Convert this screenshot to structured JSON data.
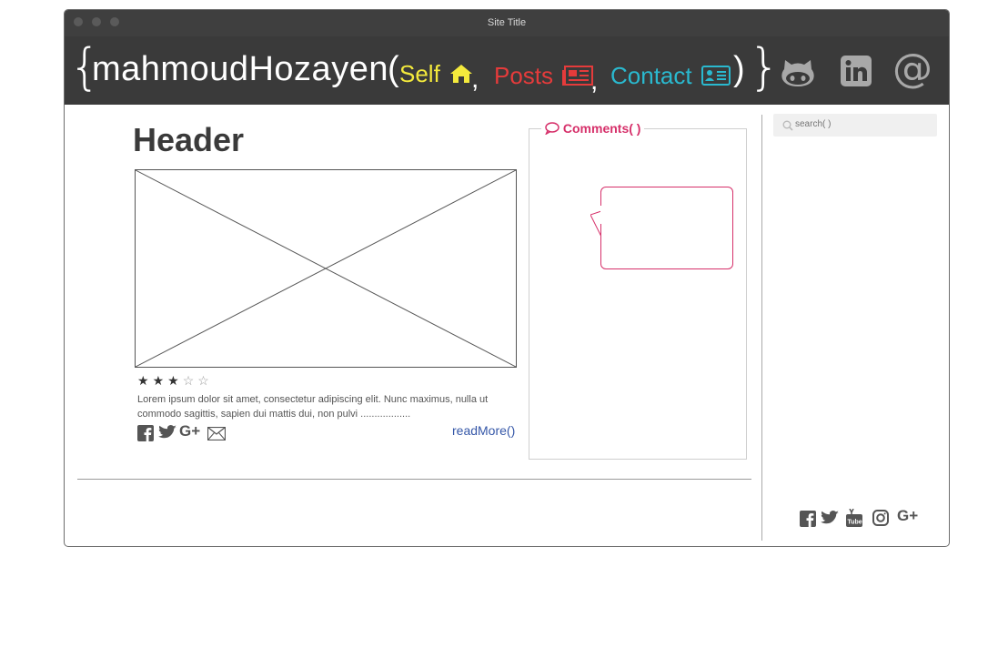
{
  "window": {
    "title": "Site Title"
  },
  "header": {
    "brand": "mahmoudHozayen",
    "open_paren": "(",
    "close_paren": ")",
    "comma": ",",
    "nav": [
      {
        "label": "Self",
        "icon": "home-icon",
        "color": "#f4ea3c"
      },
      {
        "label": "Posts",
        "icon": "newspaper-icon",
        "color": "#e53b3b"
      },
      {
        "label": "Contact",
        "icon": "contact-card-icon",
        "color": "#2ab9cf"
      }
    ],
    "right_icons": [
      "github-icon",
      "linkedin-icon",
      "at-icon"
    ]
  },
  "post": {
    "title": "Header",
    "rating": 3,
    "rating_max": 5,
    "excerpt": "Lorem ipsum dolor sit amet, consectetur adipiscing elit. Nunc maximus, nulla ut commodo sagittis, sapien dui mattis dui, non pulvi ..................",
    "read_more": "readMore()",
    "share_icons": [
      "facebook-icon",
      "twitter-icon",
      "google-plus-icon",
      "mail-icon"
    ]
  },
  "comments": {
    "label": "Comments( )"
  },
  "search": {
    "placeholder": "search( )"
  },
  "footer_social": [
    "facebook-icon",
    "twitter-icon",
    "youtube-icon",
    "instagram-icon",
    "google-plus-icon"
  ],
  "colors": {
    "header_bg": "#3a3a3a",
    "titlebar_bg": "#3f3f3f",
    "accent_pink": "#d6306a",
    "link": "#3557a8"
  }
}
